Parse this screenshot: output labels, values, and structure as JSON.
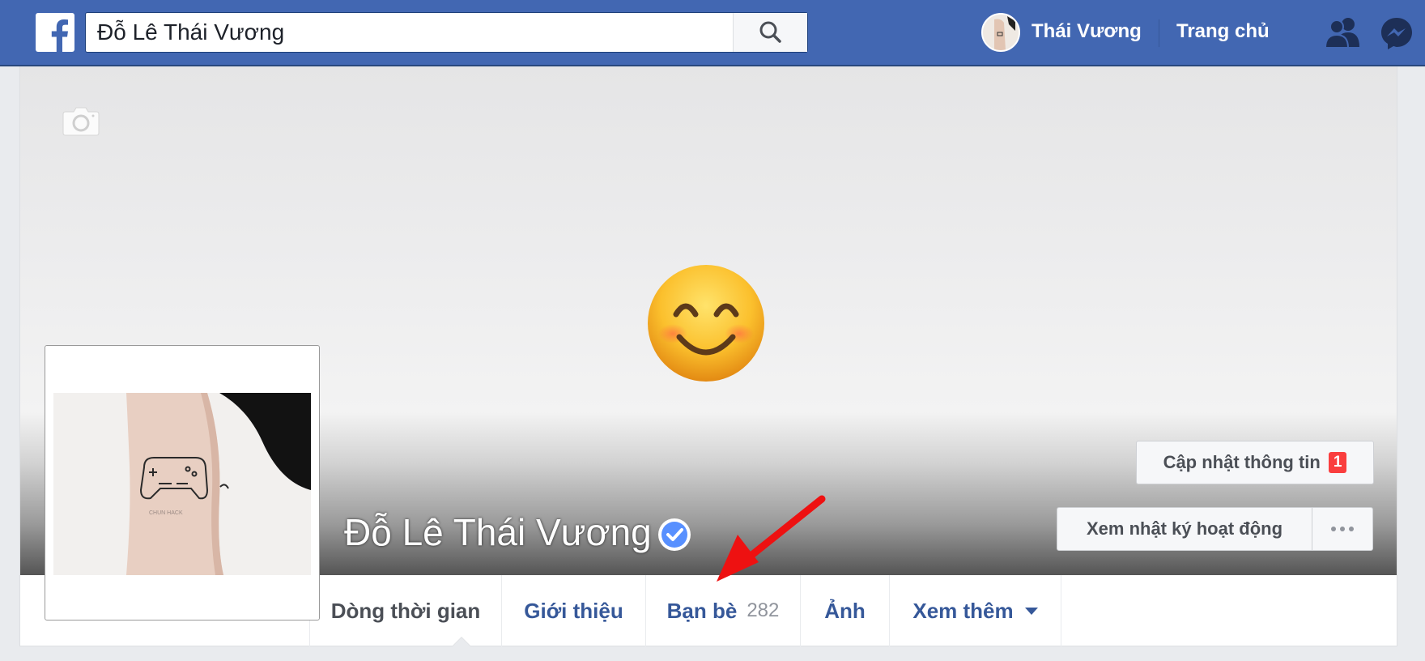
{
  "topbar": {
    "logo_icon": "facebook-f-icon",
    "search": {
      "value": "Đỗ Lê Thái Vương",
      "icon": "search-icon"
    },
    "user_name": "Thái Vương",
    "home_label": "Trang chủ",
    "icons": [
      "friend-requests-icon",
      "messenger-icon"
    ],
    "brand_color": "#4267b2"
  },
  "profile": {
    "name": "Đỗ Lê Thái Vương",
    "verified": true,
    "cover_icon": "camera-icon",
    "cover_emoji": "smiling-face-with-smiling-eyes",
    "profile_picture_caption": "CHUN HACK",
    "actions": {
      "update_info_label": "Cập nhật thông tin",
      "update_info_badge": "1",
      "activity_log_label": "Xem nhật ký hoạt động",
      "more_icon": "more-dots-icon"
    }
  },
  "annotation": {
    "arrow_color": "#ee1111"
  },
  "tabs": [
    {
      "label": "Dòng thời gian",
      "active": true
    },
    {
      "label": "Giới thiệu"
    },
    {
      "label": "Bạn bè",
      "count": "282"
    },
    {
      "label": "Ảnh"
    },
    {
      "label": "Xem thêm",
      "dropdown": true
    }
  ]
}
